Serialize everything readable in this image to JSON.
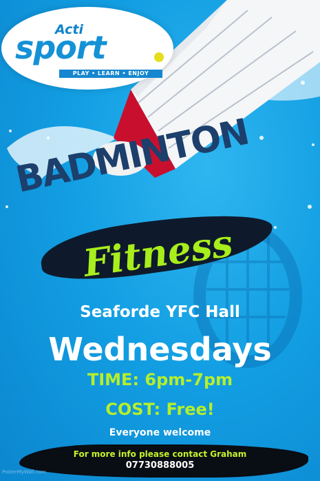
{
  "logo": {
    "brand_small": "Acti",
    "brand_large": "sport",
    "tagline": "PLAY • LEARN • ENJOY"
  },
  "headline": {
    "title": "BADMINTON",
    "subtitle": "Fitness"
  },
  "details": {
    "venue": "Seaforde YFC Hall",
    "day": "Wednesdays",
    "time": "TIME: 6pm-7pm",
    "cost": "COST: Free!",
    "welcome": "Everyone welcome"
  },
  "contact": {
    "text": "For more info please contact Graham",
    "phone": "07730888005"
  },
  "watermark": "PosterMyWall.com",
  "colors": {
    "background": "#139fe3",
    "accent_green": "#b5ef2c",
    "navy": "#1c3f6c"
  }
}
